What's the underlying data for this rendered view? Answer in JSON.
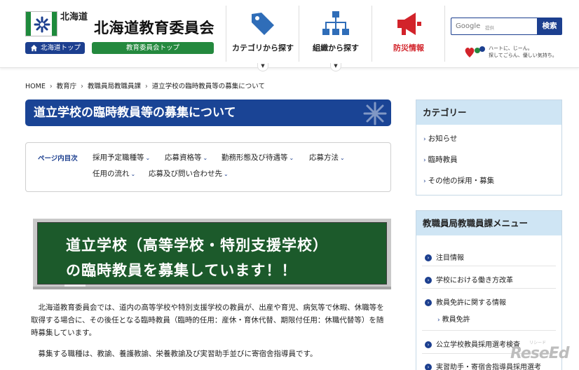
{
  "header": {
    "pref_name": "北海道",
    "home_link": "北海道トップ",
    "board_title": "北海道教育委員会",
    "board_link": "教育委員会トップ",
    "nav": [
      {
        "label": "カテゴリから探す",
        "icon": "tag-icon"
      },
      {
        "label": "組織から探す",
        "icon": "org-chart-icon"
      },
      {
        "label": "防災情報",
        "icon": "megaphone-icon"
      }
    ],
    "search": {
      "provider": "Google",
      "provider_sub": "提供",
      "button": "検索"
    },
    "heart_text_1": "ハートに、じーん。",
    "heart_text_2": "探してごらん、優しい気持ち。",
    "colors": {
      "navy": "#1c3f8f",
      "green": "#24893e",
      "red": "#d2232a",
      "title_bar": "#1a4495"
    }
  },
  "breadcrumb": [
    "HOME",
    "教育庁",
    "教職員局教職員課",
    "道立学校の臨時教員等の募集について"
  ],
  "main": {
    "title": "道立学校の臨時教員等の募集について",
    "toc": {
      "label": "ページ内目次",
      "items": [
        "採用予定職種等",
        "応募資格等",
        "勤務形態及び待遇等",
        "応募方法",
        "任用の流れ",
        "応募及び問い合わせ先"
      ]
    },
    "banner": {
      "line1": "道立学校（高等学校・特別支援学校）",
      "line2": "の臨時教員を募集しています！！"
    },
    "paragraphs": [
      "北海道教育委員会では、道内の高等学校や特別支援学校の教員が、出産や育児、病気等で休暇、休職等を取得する場合に、その後任となる臨時教員（臨時的任用：産休・育休代替、期限付任用：休職代替等）を随時募集しています。",
      "募集する職種は、教諭、養護教諭、栄養教諭及び実習助手並びに寄宿舎指導員です。"
    ]
  },
  "sidebar": {
    "category": {
      "title": "カテゴリー",
      "links": [
        "お知らせ",
        "臨時教員",
        "その他の採用・募集"
      ]
    },
    "menu": {
      "title": "教職員局教職員課メニュー",
      "items": [
        {
          "label": "注目情報"
        },
        {
          "label": "学校における働き方改革"
        },
        {
          "label": "教員免許に関する情報",
          "sub": "教員免許"
        },
        {
          "label": "公立学校教員採用選考検査"
        },
        {
          "label": "実習助手・寄宿舎指導員採用選考"
        }
      ]
    }
  },
  "watermark": {
    "text": "ReseEd",
    "sub": "リシード"
  }
}
